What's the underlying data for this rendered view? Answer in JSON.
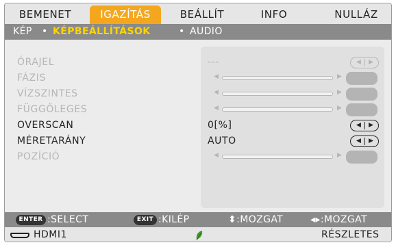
{
  "tabs": [
    {
      "label": "BEMENET",
      "active": false
    },
    {
      "label": "IGAZÍTÁS",
      "active": true
    },
    {
      "label": "BEÁLLÍT",
      "active": false
    },
    {
      "label": "INFO",
      "active": false
    },
    {
      "label": "NULLÁZ",
      "active": false
    }
  ],
  "subtabs": [
    {
      "label": "KÉP",
      "active": false
    },
    {
      "label": "•",
      "active": false
    },
    {
      "label": "KÉPBEÁLLÍTÁSOK",
      "active": true
    },
    {
      "label": "•",
      "active": false
    },
    {
      "label": "AUDIO",
      "active": false
    }
  ],
  "settings": {
    "orajel": {
      "label": "ÓRAJEL",
      "value": "---"
    },
    "fazis": {
      "label": "FÁZIS"
    },
    "vizszintes": {
      "label": "VÍZSZINTES"
    },
    "fuggoleges": {
      "label": "FÜGGŐLEGES"
    },
    "overscan": {
      "label": "OVERSCAN",
      "value": "0[%]"
    },
    "meretarany": {
      "label": "MÉRETARÁNY",
      "value": "AUTO"
    },
    "pozicio": {
      "label": "POZÍCIÓ"
    }
  },
  "glyphs": {
    "left": "◀",
    "right": "▶"
  },
  "help": {
    "enter_key": "ENTER",
    "select": ":SELECT",
    "exit_key": "EXIT",
    "exit": ":KILÉP",
    "move_vertical": "⬍:MOZGAT",
    "move_horizontal": "◂▸:MOZGAT"
  },
  "status": {
    "input": "HDMI1",
    "leaf_icon": "eco-leaf-icon",
    "details": "RÉSZLETES"
  },
  "colors": {
    "accent_tab": "#f4a71e",
    "active_subtab": "#ffd400",
    "bar_gray": "#8a8a8a",
    "disabled_text": "#b6b6b6",
    "leaf_green": "#3f9a2a"
  }
}
